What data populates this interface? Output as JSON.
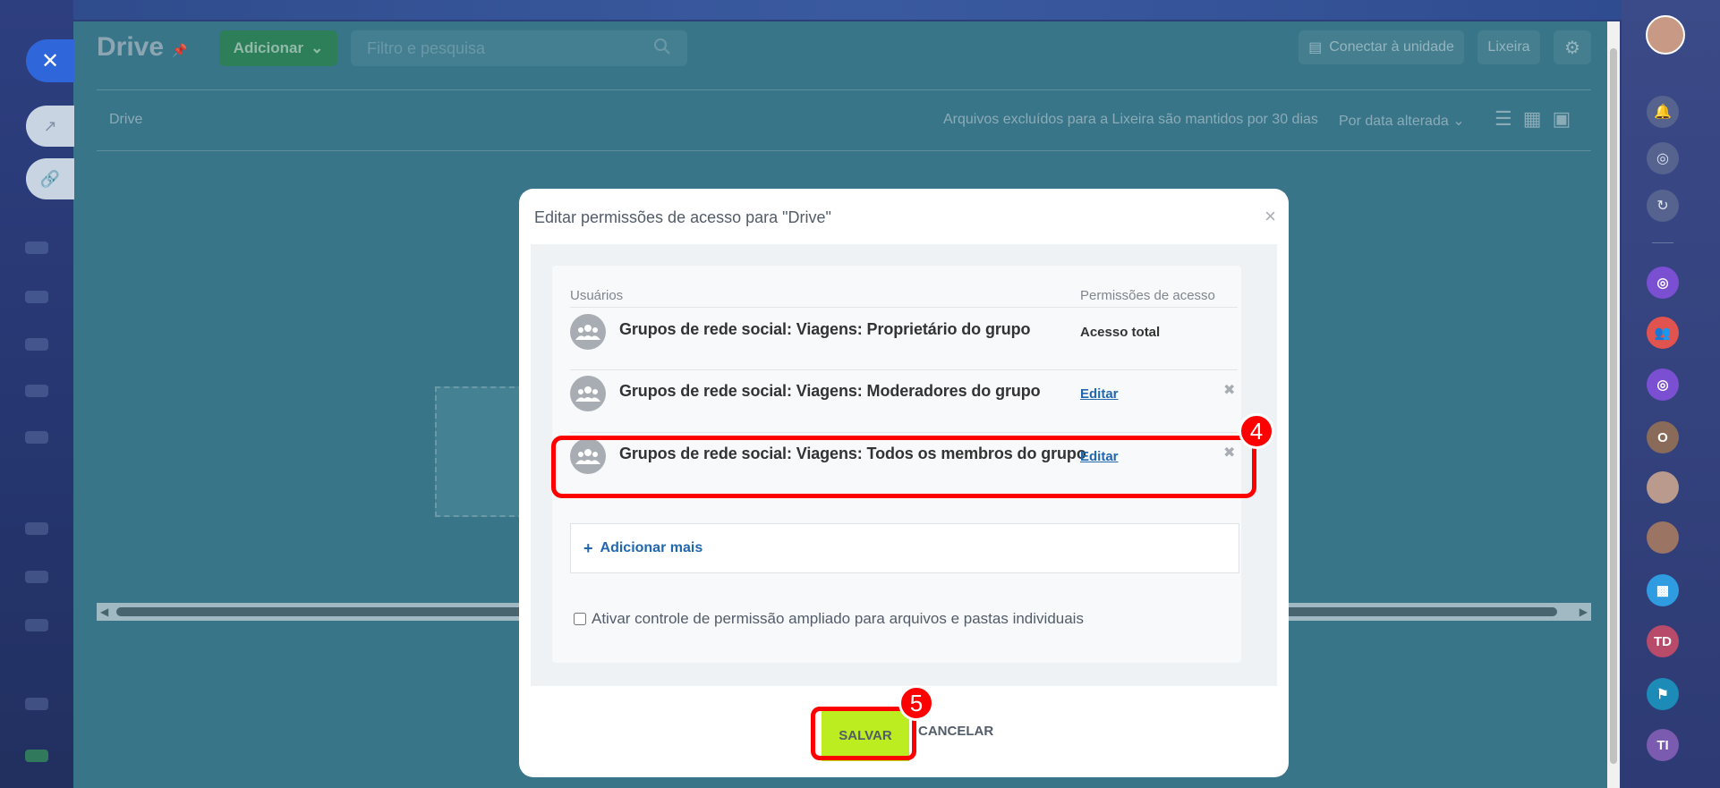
{
  "page": {
    "title": "Drive",
    "add_label": "Adicionar",
    "search_placeholder": "Filtro e pesquisa",
    "connect_label": "Conectar à unidade",
    "trash_label": "Lixeira",
    "breadcrumb": "Drive",
    "notice": "Arquivos excluídos para a Lixeira são mantidos por 30 dias",
    "sort_label": "Por data alterada"
  },
  "modal": {
    "title": "Editar permissões de acesso para \"Drive\"",
    "col_users": "Usuários",
    "col_permissions": "Permissões de acesso",
    "rows": [
      {
        "name": "Grupos de rede social: Viagens: Proprietário do grupo",
        "permission": "Acesso total"
      },
      {
        "name": "Grupos de rede social: Viagens: Moderadores do grupo",
        "action": "Editar"
      },
      {
        "name": "Grupos de rede social: Viagens: Todos os membros do grupo",
        "action": "Editar"
      }
    ],
    "add_more": "Adicionar mais",
    "checkbox_label": "Ativar controle de permissão ampliado para arquivos e pastas individuais",
    "checkbox_checked": false,
    "save_label": "SALVAR",
    "cancel_label": "CANCELAR"
  },
  "right_bar": {
    "initials_o": "O",
    "initials_td": "TD",
    "initials_ti": "TI"
  },
  "annotations": {
    "step4": "4",
    "step5": "5"
  },
  "colors": {
    "accent": "#2067b0",
    "save": "#bbed21",
    "highlight": "#ff0000"
  }
}
